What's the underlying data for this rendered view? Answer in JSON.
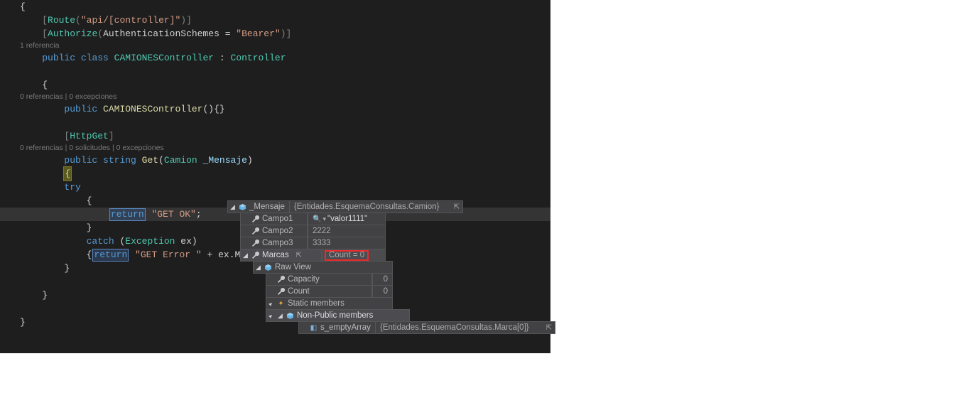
{
  "code": {
    "route_attr_open": "[",
    "route_attr_name": "Route",
    "route_args": "(\"api/[controller]\")",
    "route_attr_close": "]",
    "authorize_name": "Authorize",
    "authorize_args_pre": "(",
    "authorize_prop": "AuthenticationSchemes",
    "authorize_eq": " = ",
    "authorize_val": "\"Bearer\"",
    "authorize_args_post": ")",
    "lens_class": "1 referencia",
    "kw_public": "public",
    "kw_class": "class",
    "class_name": "CAMIONESController",
    "colon": " : ",
    "base_class": "Controller",
    "lens_ctor": "0 referencias | 0 excepciones",
    "ctor_name": "CAMIONESController",
    "ctor_parens": "(){}",
    "httpget": "HttpGet",
    "lens_get": "0 referencias | 0 solicitudes | 0 excepciones",
    "kw_string": "string",
    "get_name": "Get",
    "get_paren_open": "(",
    "param_type": "Camion",
    "param_name": "_Mensaje",
    "get_paren_close": ")",
    "kw_try": "try",
    "kw_return": "return",
    "ok_str": "\"GET OK\"",
    "kw_catch": "catch",
    "ex_type": "Exception",
    "ex_name": "ex",
    "err_str": "\"GET Error \"",
    "plus": " + ",
    "ex_mes": "ex.Mes"
  },
  "tip": {
    "root": {
      "name": "_Mensaje",
      "value": "{Entidades.EsquemaConsultas.Camion}"
    },
    "fields": [
      {
        "name": "Campo1",
        "value": "\"valor1111\"",
        "hasMag": true
      },
      {
        "name": "Campo2",
        "value": "2222",
        "hasMag": false
      },
      {
        "name": "Campo3",
        "value": "3333",
        "hasMag": false
      }
    ],
    "marcas": {
      "name": "Marcas",
      "value": "Count = 0"
    },
    "rawview": "Raw View",
    "raw_items": [
      {
        "name": "Capacity",
        "value": "0"
      },
      {
        "name": "Count",
        "value": "0"
      }
    ],
    "static_members": "Static members",
    "nonpublic": "Non-Public members",
    "empty_arr": {
      "name": "s_emptyArray",
      "value": "{Entidades.EsquemaConsultas.Marca[0]}"
    }
  }
}
